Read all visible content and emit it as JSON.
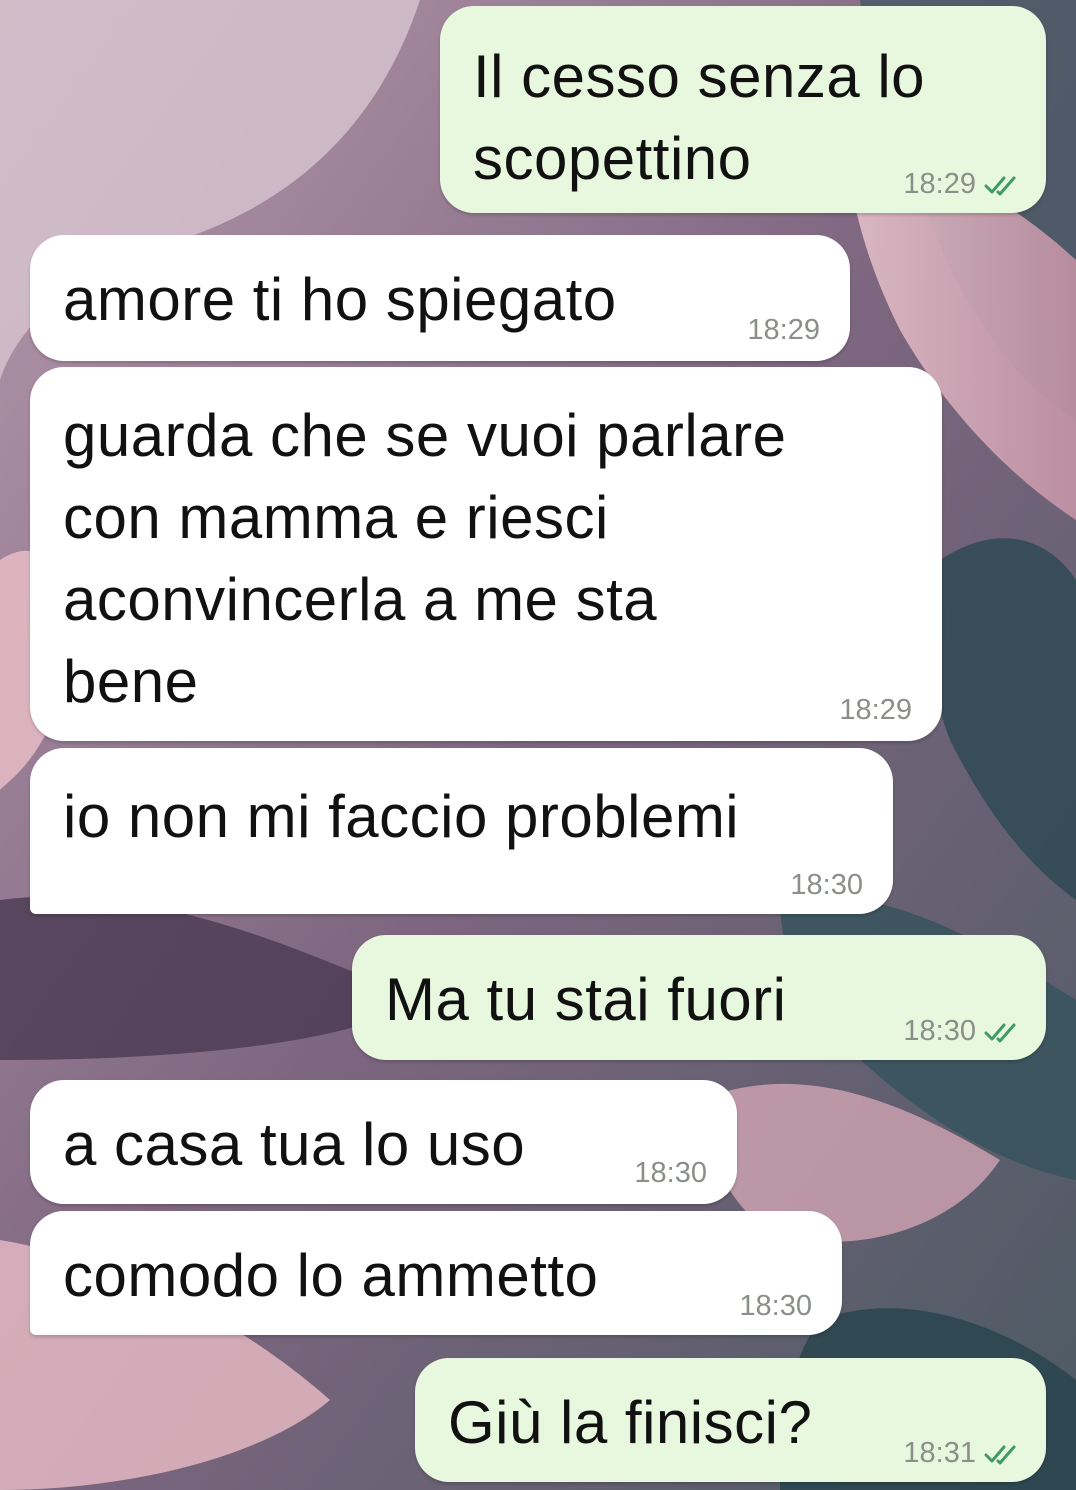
{
  "chat": {
    "messages": [
      {
        "direction": "outgoing",
        "text": "Il cesso senza lo\nscopettino",
        "time": "18:29",
        "status": "read"
      },
      {
        "direction": "incoming",
        "text": "amore ti ho spiegato",
        "time": "18:29"
      },
      {
        "direction": "incoming",
        "text": "guarda che se vuoi parlare\ncon mamma e riesci\naconvincerla a me sta\nbene",
        "time": "18:29"
      },
      {
        "direction": "incoming",
        "text": "io non mi faccio problemi",
        "time": "18:30"
      },
      {
        "direction": "outgoing",
        "text": "Ma tu stai fuori",
        "time": "18:30",
        "status": "read"
      },
      {
        "direction": "incoming",
        "text": "a casa tua lo uso",
        "time": "18:30"
      },
      {
        "direction": "incoming",
        "text": "comodo lo ammetto",
        "time": "18:30"
      },
      {
        "direction": "outgoing",
        "text": "Giù la finisci?",
        "time": "18:31",
        "status": "read"
      }
    ]
  },
  "colors": {
    "incoming_bubble": "#ffffff",
    "outgoing_bubble": "#e8f8df",
    "read_tick": "#3f9a68",
    "time_text": "#8a8f8a"
  },
  "icons": {
    "read_status": "double-check-icon"
  }
}
